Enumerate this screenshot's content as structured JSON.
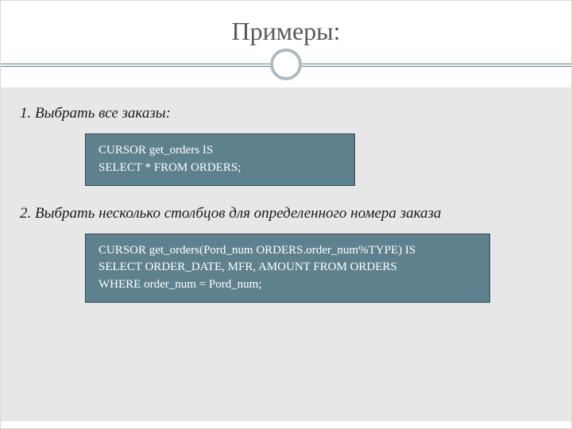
{
  "title": "Примеры:",
  "section1": {
    "caption": "1. Выбрать все заказы:",
    "code": "CURSOR get_orders IS\nSELECT * FROM ORDERS;"
  },
  "section2": {
    "caption": "2. Выбрать несколько столбцов для определенного номера заказа",
    "code": "CURSOR get_orders(Pord_num ORDERS.order_num%TYPE) IS\nSELECT ORDER_DATE, MFR, AMOUNT FROM ORDERS\nWHERE order_num = Pord_num;"
  }
}
